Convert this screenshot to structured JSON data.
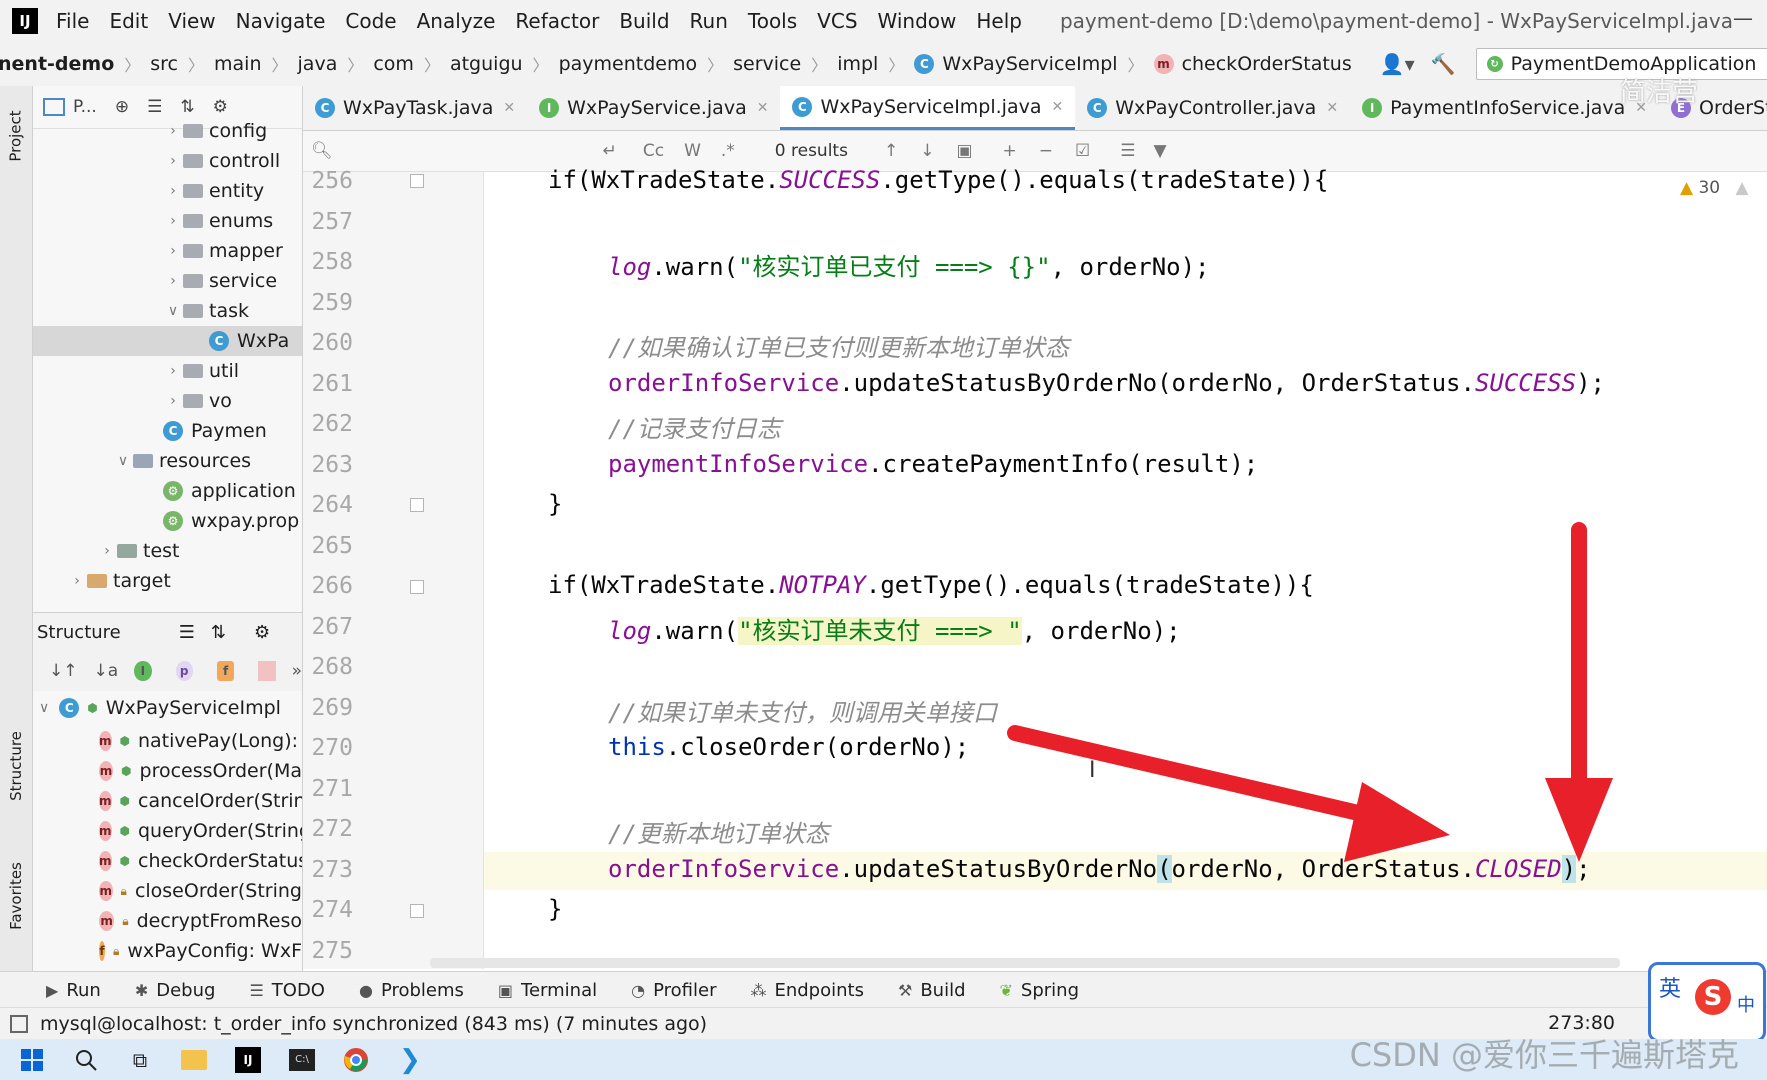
{
  "menubar": {
    "logo": "IJ",
    "items": [
      "File",
      "Edit",
      "View",
      "Navigate",
      "Code",
      "Analyze",
      "Refactor",
      "Build",
      "Run",
      "Tools",
      "VCS",
      "Window",
      "Help"
    ],
    "title": "payment-demo [D:\\demo\\payment-demo] - WxPayServiceImpl.java"
  },
  "breadcrumb": {
    "items": [
      "nent-demo",
      "src",
      "main",
      "java",
      "com",
      "atguigu",
      "paymentdemo",
      "service",
      "impl",
      "WxPayServiceImpl",
      "checkOrderStatus"
    ],
    "run_config": "PaymentDemoApplication"
  },
  "project_panel": {
    "header_label": "P...",
    "tree": [
      {
        "label": "config",
        "indent": 1,
        "type": "folder"
      },
      {
        "label": "controll",
        "indent": 1,
        "type": "folder"
      },
      {
        "label": "entity",
        "indent": 1,
        "type": "folder"
      },
      {
        "label": "enums",
        "indent": 1,
        "type": "folder"
      },
      {
        "label": "mapper",
        "indent": 1,
        "type": "folder"
      },
      {
        "label": "service",
        "indent": 1,
        "type": "folder"
      },
      {
        "label": "task",
        "indent": 1,
        "type": "folder",
        "expanded": true
      },
      {
        "label": "WxPa",
        "indent": 2,
        "type": "class",
        "selected": true
      },
      {
        "label": "util",
        "indent": 1,
        "type": "folder"
      },
      {
        "label": "vo",
        "indent": 1,
        "type": "folder"
      },
      {
        "label": "Paymen",
        "indent": 1,
        "type": "app"
      },
      {
        "label": "resources",
        "indent": 0,
        "type": "res",
        "expanded": true
      },
      {
        "label": "application",
        "indent": 1,
        "type": "yml"
      },
      {
        "label": "wxpay.prop",
        "indent": 1,
        "type": "yml"
      },
      {
        "label": "test",
        "indent": -1,
        "type": "test"
      },
      {
        "label": "target",
        "indent": -2,
        "type": "target"
      }
    ]
  },
  "structure_panel": {
    "title": "Structure",
    "root": "WxPayServiceImpl",
    "members": [
      {
        "icon": "m",
        "label": "nativePay(Long): M"
      },
      {
        "icon": "m",
        "label": "processOrder(Ma"
      },
      {
        "icon": "m",
        "label": "cancelOrder(Strin"
      },
      {
        "icon": "m",
        "label": "queryOrder(String"
      },
      {
        "icon": "m",
        "label": "checkOrderStatus"
      },
      {
        "icon": "m",
        "label": "closeOrder(String"
      },
      {
        "icon": "m",
        "label": "decryptFromReso"
      },
      {
        "icon": "f",
        "label": "wxPayConfig: WxF"
      }
    ]
  },
  "editor_tabs": [
    {
      "label": "WxPayTask.java",
      "icon": "C",
      "kind": "class"
    },
    {
      "label": "WxPayService.java",
      "icon": "I",
      "kind": "int"
    },
    {
      "label": "WxPayServiceImpl.java",
      "icon": "C",
      "kind": "class",
      "active": true
    },
    {
      "label": "WxPayController.java",
      "icon": "C",
      "kind": "class"
    },
    {
      "label": "PaymentInfoService.java",
      "icon": "I",
      "kind": "int"
    },
    {
      "label": "OrderStatus.java",
      "icon": "E",
      "kind": "enum"
    }
  ],
  "search": {
    "placeholder": "",
    "results": "0 results"
  },
  "warnings": "30",
  "line_numbers": [
    "256",
    "257",
    "258",
    "259",
    "260",
    "261",
    "262",
    "263",
    "264",
    "265",
    "266",
    "267",
    "268",
    "269",
    "270",
    "271",
    "272",
    "273",
    "274",
    "275"
  ],
  "code": {
    "l256": {
      "a": "if(WxTradeState.",
      "b": "SUCCESS",
      "c": ".getType().equals(tradeState)){"
    },
    "l258": {
      "a": "log",
      "b": ".warn(",
      "c": "\"核实订单已支付 ===> {}\"",
      "d": ", orderNo);"
    },
    "l259": "//如果确认订单已支付则更新本地订单状态",
    "l260": {
      "a": "orderInfoService",
      "b": ".updateStatusByOrderNo(orderNo, OrderStatus.",
      "c": "SUCCESS",
      "d": ");"
    },
    "l261": "//记录支付日志",
    "l262": {
      "a": "paymentInfoService",
      "b": ".createPaymentInfo(result);"
    },
    "l263": "}",
    "l265": {
      "a": "if(WxTradeState.",
      "b": "NOTPAY",
      "c": ".getType().equals(tradeState)){"
    },
    "l266": {
      "a": "log",
      "b": ".warn(",
      "c": "\"核实订单未支付 ===> \"",
      "d": ", orderNo);"
    },
    "l268": "//如果订单未支付，则调用关单接口",
    "l269": {
      "a": "this",
      "b": ".closeOrder(orderNo);"
    },
    "l271": "//更新本地订单状态",
    "l272": {
      "a": "orderInfoService",
      "b": ".updateStatusByOrderNo",
      "c": "(",
      "d": "orderNo, OrderStatus.",
      "e": "CLOSED",
      "f": ")",
      "g": ";"
    },
    "l273": "}"
  },
  "bottom_tabs": [
    "Run",
    "Debug",
    "TODO",
    "Problems",
    "Terminal",
    "Profiler",
    "Endpoints",
    "Build",
    "Spring"
  ],
  "status": {
    "message": "mysql@localhost: t_order_info synchronized (843 ms) (7 minutes ago)",
    "caret": "273:80"
  },
  "ime": {
    "top": "英",
    "badge": "S",
    "right": "中"
  },
  "watermark": "CSDN @爱你三千遍斯塔克",
  "overlay_text": "简洁营",
  "colors": {
    "arrow": "#e8202a",
    "active_tab_underline": "#4a88c7",
    "keyword": "#0033b3",
    "field": "#871094",
    "string": "#067d17"
  }
}
